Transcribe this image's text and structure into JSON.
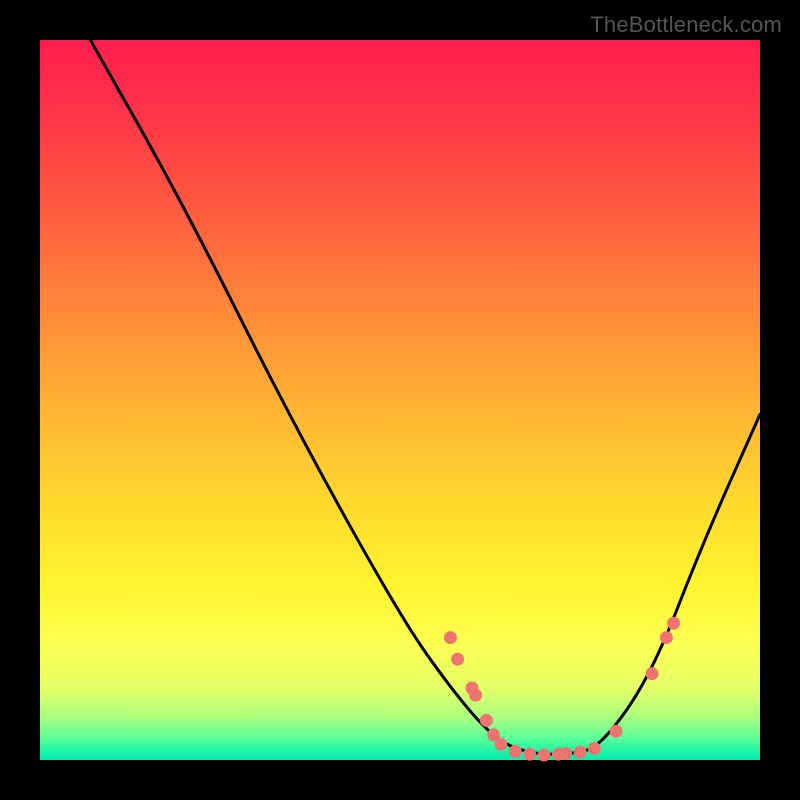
{
  "source_label": "TheBottleneck.com",
  "chart_data": {
    "type": "line",
    "title": "",
    "xlabel": "",
    "ylabel": "",
    "xlim": [
      0,
      100
    ],
    "ylim": [
      0,
      100
    ],
    "curve_points": [
      {
        "x": 7,
        "y": 100
      },
      {
        "x": 20,
        "y": 77
      },
      {
        "x": 35,
        "y": 47
      },
      {
        "x": 50,
        "y": 20
      },
      {
        "x": 57,
        "y": 10
      },
      {
        "x": 63,
        "y": 3
      },
      {
        "x": 68,
        "y": 0.8
      },
      {
        "x": 74,
        "y": 0.8
      },
      {
        "x": 78,
        "y": 2
      },
      {
        "x": 85,
        "y": 12
      },
      {
        "x": 92,
        "y": 30
      },
      {
        "x": 100,
        "y": 48
      }
    ],
    "marker_points": [
      {
        "x": 57,
        "y": 17
      },
      {
        "x": 58,
        "y": 14
      },
      {
        "x": 60,
        "y": 10
      },
      {
        "x": 60.5,
        "y": 9
      },
      {
        "x": 62,
        "y": 5.5
      },
      {
        "x": 63,
        "y": 3.5
      },
      {
        "x": 64,
        "y": 2.2
      },
      {
        "x": 66,
        "y": 1.2
      },
      {
        "x": 68,
        "y": 0.8
      },
      {
        "x": 70,
        "y": 0.7
      },
      {
        "x": 72,
        "y": 0.8
      },
      {
        "x": 73,
        "y": 0.9
      },
      {
        "x": 75,
        "y": 1.1
      },
      {
        "x": 77,
        "y": 1.6
      },
      {
        "x": 80,
        "y": 4
      },
      {
        "x": 85,
        "y": 12
      },
      {
        "x": 87,
        "y": 17
      },
      {
        "x": 88,
        "y": 19
      }
    ],
    "marker_color": "#ee7470",
    "curve_color": "#000000"
  }
}
